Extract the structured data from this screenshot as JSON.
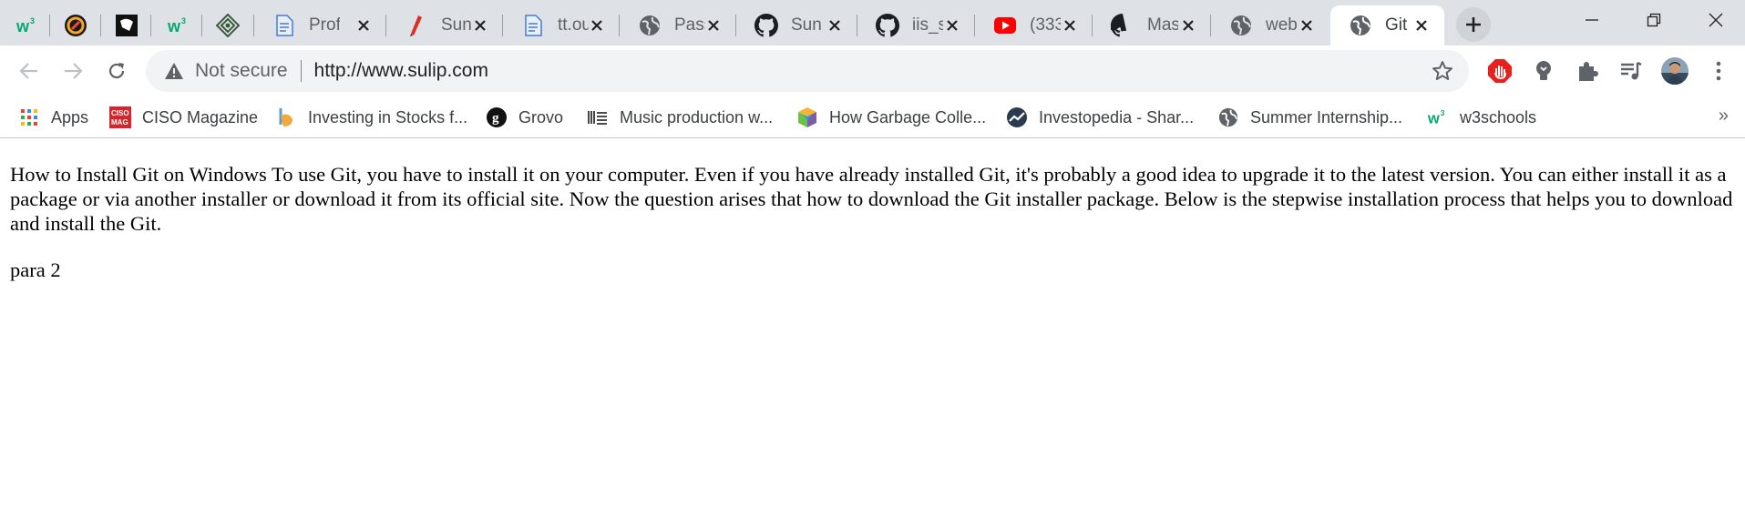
{
  "tabs": [
    {
      "title": "",
      "icon": "w3schools-icon",
      "active": false
    },
    {
      "title": "",
      "icon": "app-logo-icon",
      "active": false
    },
    {
      "title": "",
      "icon": "dark-logo-icon",
      "active": false
    },
    {
      "title": "",
      "icon": "w3schools-icon",
      "active": false
    },
    {
      "title": "",
      "icon": "diamond-logo-icon",
      "active": false
    },
    {
      "title": "Prof",
      "icon": "document-icon",
      "active": false
    },
    {
      "title": "Suni",
      "icon": "pen-icon",
      "active": false
    },
    {
      "title": "tt.ou",
      "icon": "document-icon",
      "active": false
    },
    {
      "title": "Pass",
      "icon": "globe-icon",
      "active": false
    },
    {
      "title": "Suni",
      "icon": "github-icon",
      "active": false
    },
    {
      "title": "iis_s",
      "icon": "github-icon",
      "active": false
    },
    {
      "title": "(333",
      "icon": "youtube-icon",
      "active": false
    },
    {
      "title": "Mas",
      "icon": "github-icon",
      "active": false
    },
    {
      "title": "web",
      "icon": "globe-icon",
      "active": false
    },
    {
      "title": "Git",
      "icon": "globe-icon",
      "active": true
    }
  ],
  "toolbar": {
    "security_label": "Not secure",
    "url": "http://www.sulip.com"
  },
  "bookmarks": [
    {
      "label": "Apps",
      "icon": "apps-grid-icon"
    },
    {
      "label": "CISO Magazine",
      "icon": "ciso-mag-icon"
    },
    {
      "label": "Investing in Stocks f...",
      "icon": "investing-icon"
    },
    {
      "label": "Grovo",
      "icon": "grovo-icon"
    },
    {
      "label": "Music production w...",
      "icon": "music-bars-icon"
    },
    {
      "label": "How Garbage Colle...",
      "icon": "colorful-cube-icon"
    },
    {
      "label": "Investopedia - Shar...",
      "icon": "investopedia-icon"
    },
    {
      "label": "Summer Internship...",
      "icon": "globe-icon"
    },
    {
      "label": "w3schools",
      "icon": "w3schools-icon"
    }
  ],
  "bookmarks_more": "»",
  "content": {
    "para1": "How to Install Git on Windows To use Git, you have to install it on your computer. Even if you have already installed Git, it's probably a good idea to upgrade it to the latest version. You can either install it as a package or via another installer or download it from its official site. Now the question arises that how to download the Git installer package. Below is the stepwise installation process that helps you to download and install the Git.",
    "para2": "para 2"
  },
  "colors": {
    "tabstrip_bg": "#dee1e6",
    "omnibox_bg": "#f1f3f4",
    "w3_green": "#04aa6d",
    "youtube_red": "#ff0000"
  }
}
